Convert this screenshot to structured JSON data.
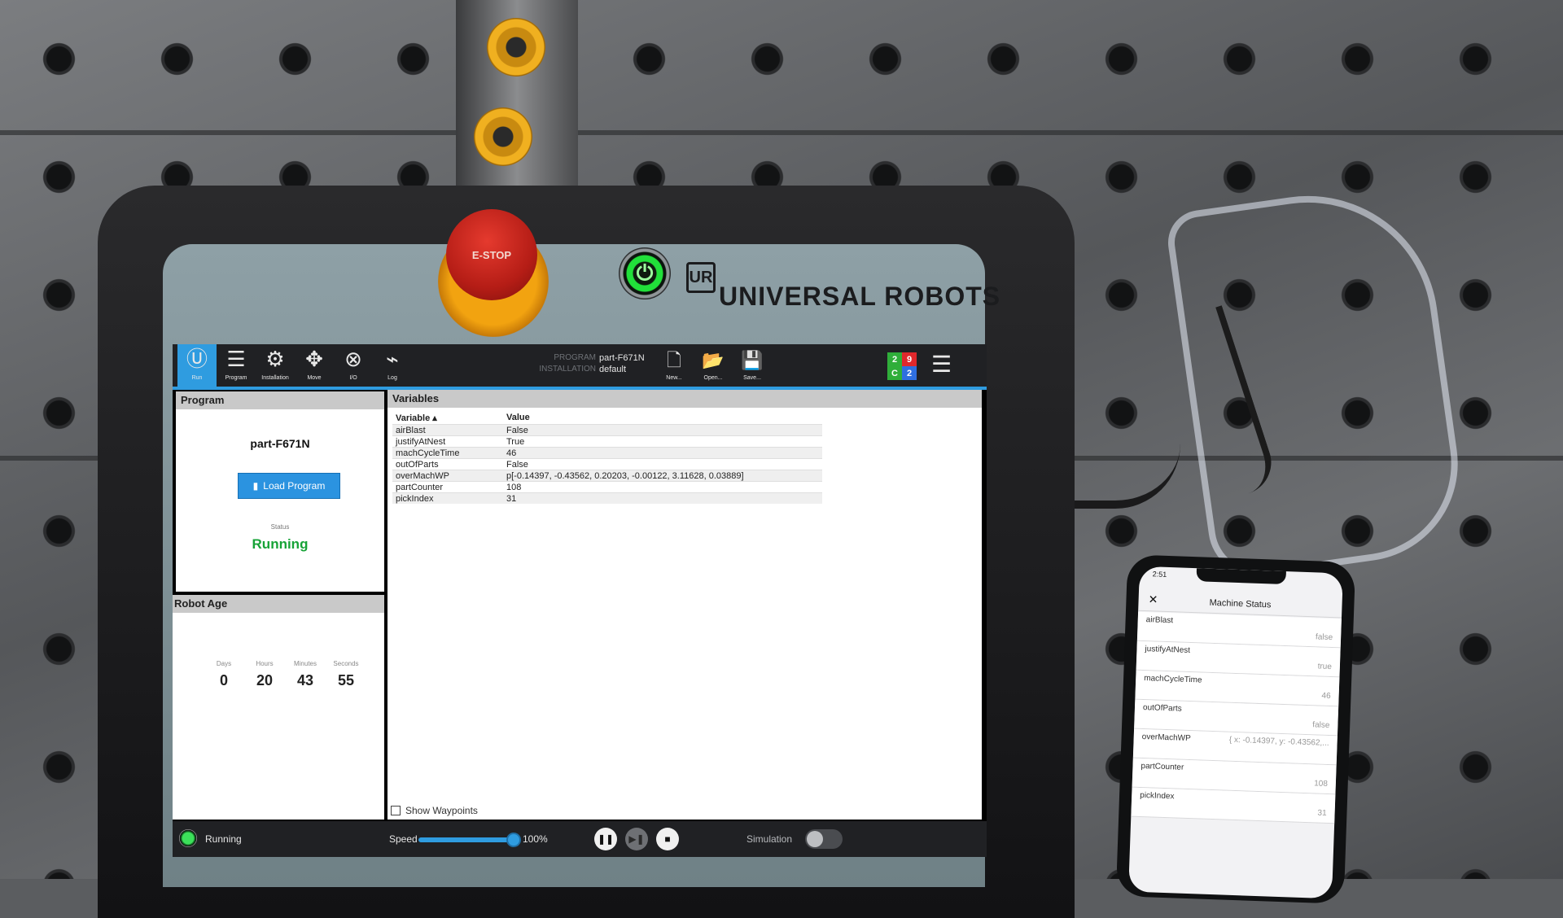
{
  "pendant": {
    "estop_label": "E-STOP",
    "power_symbol": "⏻",
    "logo_text": "UR",
    "brand": "UNIVERSAL ROBOTS"
  },
  "topbar": {
    "nav": [
      {
        "label": "Run",
        "icon": "ur-run-icon"
      },
      {
        "label": "Program",
        "icon": "program-icon"
      },
      {
        "label": "Installation",
        "icon": "installation-icon"
      },
      {
        "label": "Move",
        "icon": "move-icon"
      },
      {
        "label": "I/O",
        "icon": "io-icon"
      },
      {
        "label": "Log",
        "icon": "log-icon"
      }
    ],
    "program_label": "PROGRAM",
    "program_value": "part-F671N",
    "installation_label": "INSTALLATION",
    "installation_value": "default",
    "file_buttons": [
      {
        "label": "New...",
        "icon": "new-file-icon"
      },
      {
        "label": "Open...",
        "icon": "open-folder-icon"
      },
      {
        "label": "Save...",
        "icon": "save-icon"
      }
    ],
    "tcp_counts": [
      "2",
      "9",
      "C",
      "2"
    ],
    "tcp_colors": [
      "#2fae3a",
      "#e0282c",
      "#2fae3a",
      "#2f6fe0"
    ]
  },
  "program": {
    "header": "Program",
    "name": "part-F671N",
    "load_button": "Load Program",
    "status_label": "Status",
    "status_value": "Running"
  },
  "robot_age": {
    "header": "Robot Age",
    "units": [
      {
        "label": "Days",
        "value": "0"
      },
      {
        "label": "Hours",
        "value": "20"
      },
      {
        "label": "Minutes",
        "value": "43"
      },
      {
        "label": "Seconds",
        "value": "55"
      }
    ]
  },
  "variables": {
    "header": "Variables",
    "columns": [
      "Variable ▴",
      "Value"
    ],
    "rows": [
      [
        "airBlast",
        "False"
      ],
      [
        "justifyAtNest",
        "True"
      ],
      [
        "machCycleTime",
        "46"
      ],
      [
        "outOfParts",
        "False"
      ],
      [
        "overMachWP",
        "p[-0.14397, -0.43562, 0.20203, -0.00122, 3.11628, 0.03889]"
      ],
      [
        "partCounter",
        "108"
      ],
      [
        "pickIndex",
        "31"
      ]
    ],
    "show_waypoints": "Show Waypoints"
  },
  "bottombar": {
    "state": "Running",
    "speed_label": "Speed",
    "speed_value": "100%",
    "speed_fraction": 1.0,
    "simulation_label": "Simulation",
    "pause_glyph": "❚❚",
    "step_glyph": "▶❚",
    "stop_glyph": "■"
  },
  "phone": {
    "time": "2:51",
    "close": "✕",
    "title": "Machine Status",
    "rows": [
      [
        "airBlast",
        "false"
      ],
      [
        "justifyAtNest",
        "true"
      ],
      [
        "machCycleTime",
        "46"
      ],
      [
        "outOfParts",
        "false"
      ],
      [
        "overMachWP",
        "{ x: -0.14397, y: -0.43562,..."
      ],
      [
        "partCounter",
        "108"
      ],
      [
        "pickIndex",
        "31"
      ]
    ]
  }
}
